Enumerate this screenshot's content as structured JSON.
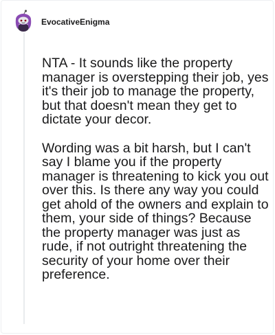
{
  "comment": {
    "author": "EvocativeEnigma",
    "avatar_icon": "snoo-avatar-icon",
    "paragraphs": [
      "NTA - It sounds like the property manager is overstepping their job, yes it's their job to manage the property, but that doesn't mean they get to dictate your decor.",
      "Wording was a bit harsh, but I can't say I blame you if the property manager is threatening to kick you out over this. Is there any way you could get ahold of the owners and explain to them, your side of things? Because the property manager was just as rude, if not outright threatening the security of your home over their preference."
    ]
  },
  "colors": {
    "text": "#1a1a1b",
    "thread_line": "#e9ebed",
    "avatar_hair": "#8a4bb3",
    "avatar_body": "#3a2a4a"
  }
}
